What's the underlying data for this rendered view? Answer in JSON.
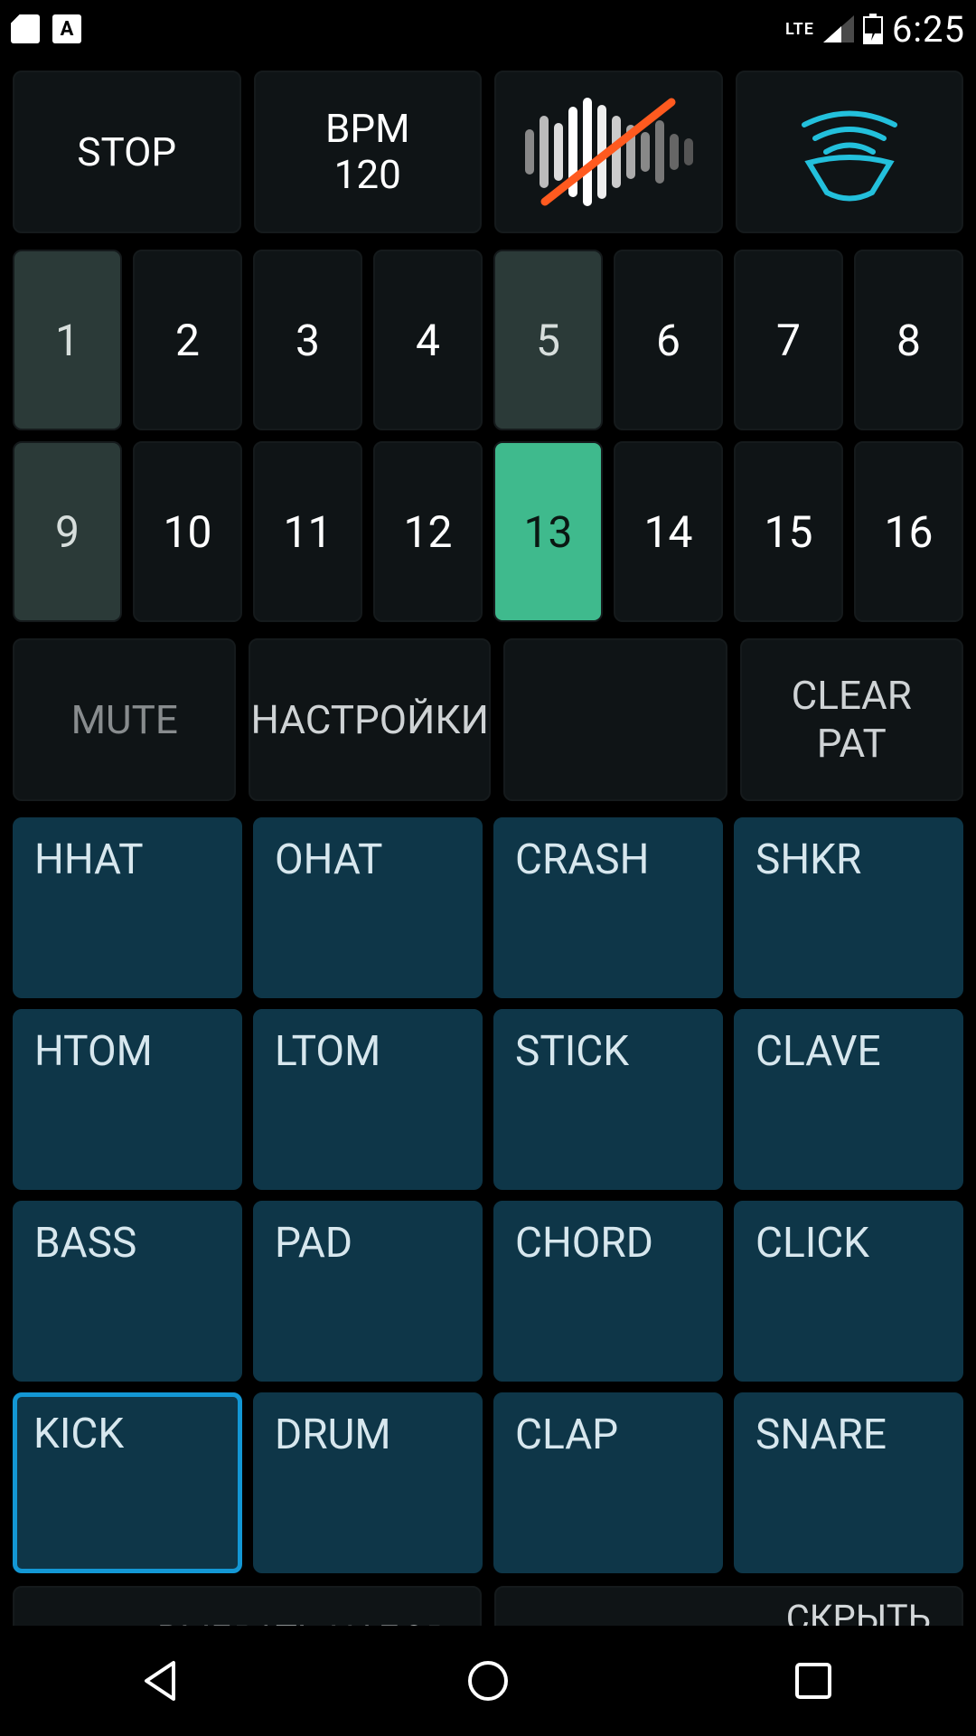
{
  "status": {
    "lang_badge": "A",
    "network_label": "LTE",
    "time": "6:25"
  },
  "top": {
    "stop": "STOP",
    "bpm_label": "BPM",
    "bpm_value": "120"
  },
  "steps": {
    "labels": [
      "1",
      "2",
      "3",
      "4",
      "5",
      "6",
      "7",
      "8",
      "9",
      "10",
      "11",
      "12",
      "13",
      "14",
      "15",
      "16"
    ],
    "dim": [
      true,
      false,
      false,
      false,
      true,
      false,
      false,
      false,
      true,
      false,
      false,
      false,
      false,
      false,
      false,
      false
    ],
    "active_index": 12
  },
  "controls": {
    "mute": "MUTE",
    "settings": "НАСТРОЙКИ",
    "clear": "CLEAR\nPAT"
  },
  "pads": {
    "labels": [
      "HHAT",
      "OHAT",
      "CRASH",
      "SHKR",
      "HTOM",
      "LTOM",
      "STICK",
      "CLAVE",
      "BASS",
      "PAD",
      "CHORD",
      "CLICK",
      "KICK",
      "DRUM",
      "CLAP",
      "SNARE"
    ],
    "selected_index": 12
  },
  "bottom": {
    "choose_kit": "ВЫБРАТЬ НАБОР",
    "hide_sequencer": "СКРЫТЬ\nСЕКВЕНСОР"
  },
  "colors": {
    "accent_green": "#3fba8d",
    "accent_cyan": "#23c0dc",
    "pad_bg": "#0e3648",
    "pad_selected": "#1397d4"
  }
}
